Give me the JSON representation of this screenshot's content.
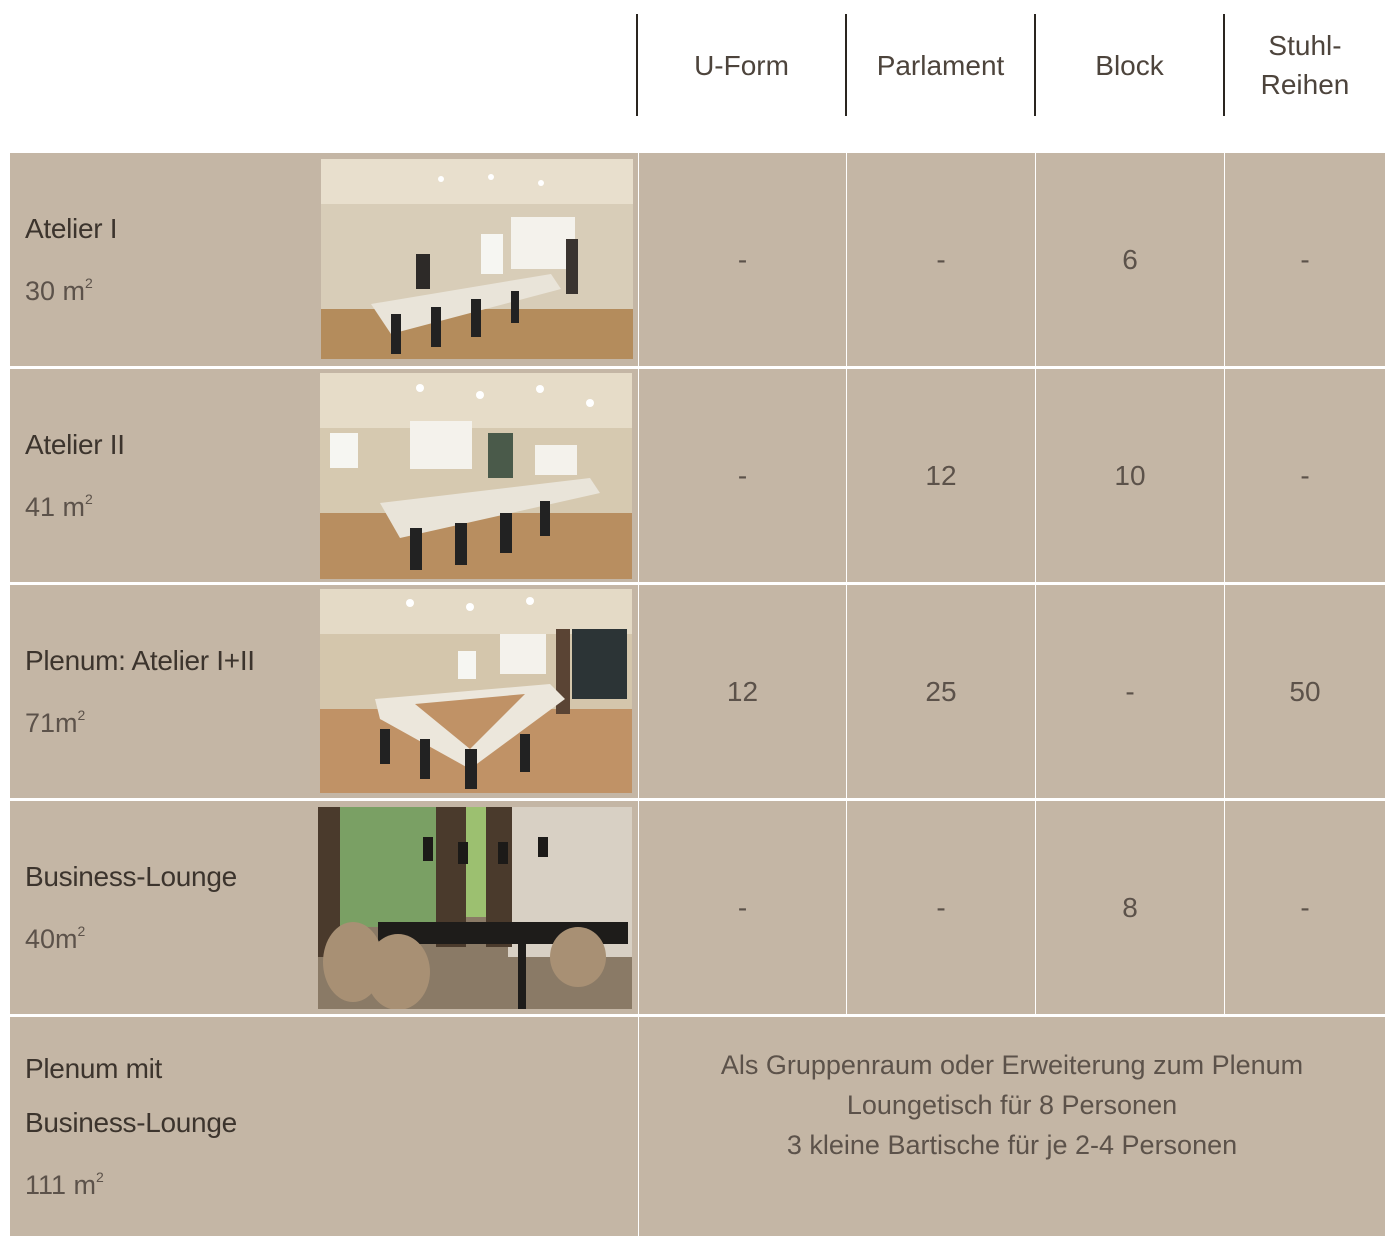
{
  "columns": [
    {
      "label": "U-Form"
    },
    {
      "label": "Parlament"
    },
    {
      "label": "Block"
    },
    {
      "label_line1": "Stuhl-",
      "label_line2": "Reihen"
    }
  ],
  "rooms": [
    {
      "name": "Atelier I",
      "size": "30 m",
      "sup": "2",
      "photo": "meeting-room-photo",
      "u_form": "-",
      "parlament": "-",
      "block": "6",
      "stuhlreihen": "-"
    },
    {
      "name": "Atelier II",
      "size": "41 m",
      "sup": "2",
      "photo": "meeting-room-photo",
      "u_form": "-",
      "parlament": "12",
      "block": "10",
      "stuhlreihen": "-"
    },
    {
      "name": "Plenum: Atelier I+II",
      "size": "71m",
      "sup": "2",
      "photo": "meeting-room-photo",
      "u_form": "12",
      "parlament": "25",
      "block": "-",
      "stuhlreihen": "50"
    },
    {
      "name": "Business-Lounge",
      "size": "40m",
      "sup": "2",
      "photo": "lounge-photo",
      "u_form": "-",
      "parlament": "-",
      "block": "8",
      "stuhlreihen": "-"
    }
  ],
  "combined": {
    "name_line1": "Plenum mit",
    "name_line2": "Business-Lounge",
    "size": "111 m",
    "sup": "2",
    "note_line1": "Als Gruppenraum oder Erweiterung zum Plenum",
    "note_line2": "Loungetisch für 8 Personen",
    "note_line3": "3 kleine Bartische für je 2-4 Personen"
  },
  "colors": {
    "cell_bg": "#c4b6a5",
    "header_divider": "#2a2520",
    "text": "#5c524a"
  }
}
